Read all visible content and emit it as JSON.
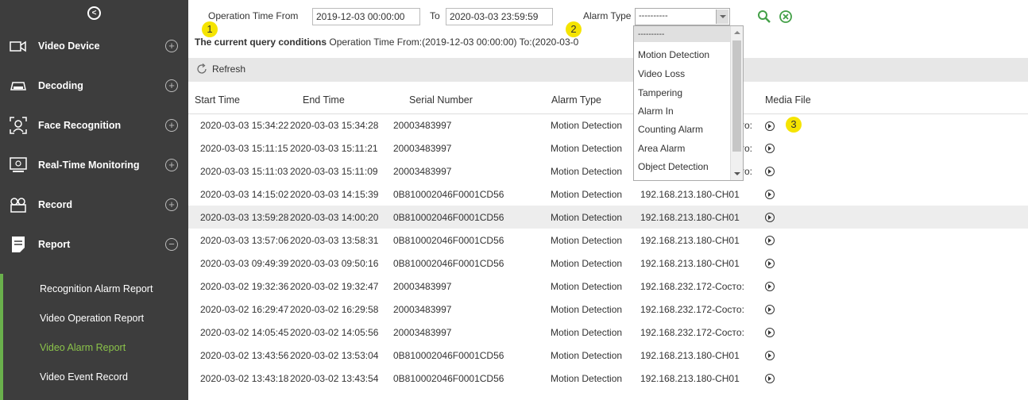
{
  "sidebar": {
    "items": [
      {
        "label": "Video Device",
        "icon": "video-device-icon",
        "expand": "+"
      },
      {
        "label": "Decoding",
        "icon": "decoding-icon",
        "expand": "+"
      },
      {
        "label": "Face Recognition",
        "icon": "face-recognition-icon",
        "expand": "+"
      },
      {
        "label": "Real-Time Monitoring",
        "icon": "monitor-icon",
        "expand": "+"
      },
      {
        "label": "Record",
        "icon": "record-icon",
        "expand": "+"
      },
      {
        "label": "Report",
        "icon": "report-icon",
        "expand": "−"
      }
    ],
    "submenu": [
      {
        "label": "Recognition Alarm Report"
      },
      {
        "label": "Video Operation Report"
      },
      {
        "label": "Video Alarm Report"
      },
      {
        "label": "Video Event Record"
      }
    ]
  },
  "filter": {
    "from_label": "Operation Time From",
    "from_value": "2019-12-03 00:00:00",
    "to_label": "To",
    "to_value": "2020-03-03 23:59:59",
    "alarm_type_label": "Alarm Type",
    "alarm_type_value": "----------"
  },
  "condition": {
    "label": "The current query conditions",
    "text": "Operation Time From:(2019-12-03 00:00:00)  To:(2020-03-0"
  },
  "toolbar": {
    "refresh_label": "Refresh"
  },
  "table": {
    "headers": [
      "Start Time",
      "End Time",
      "Serial Number",
      "Alarm Type",
      "",
      "Media File"
    ],
    "rows": [
      [
        "2020-03-03 15:34:22",
        "2020-03-03 15:34:28",
        "20003483997",
        "Motion Detection",
        "cтo:"
      ],
      [
        "2020-03-03 15:11:15",
        "2020-03-03 15:11:21",
        "20003483997",
        "Motion Detection",
        "cтo:"
      ],
      [
        "2020-03-03 15:11:03",
        "2020-03-03 15:11:09",
        "20003483997",
        "Motion Detection",
        "cтo:"
      ],
      [
        "2020-03-03 14:15:02",
        "2020-03-03 14:15:39",
        "0B810002046F0001CD56",
        "Motion Detection",
        "192.168.213.180-CH01"
      ],
      [
        "2020-03-03 13:59:28",
        "2020-03-03 14:00:20",
        "0B810002046F0001CD56",
        "Motion Detection",
        "192.168.213.180-CH01"
      ],
      [
        "2020-03-03 13:57:06",
        "2020-03-03 13:58:31",
        "0B810002046F0001CD56",
        "Motion Detection",
        "192.168.213.180-CH01"
      ],
      [
        "2020-03-03 09:49:39",
        "2020-03-03 09:50:16",
        "0B810002046F0001CD56",
        "Motion Detection",
        "192.168.213.180-CH01"
      ],
      [
        "2020-03-02 19:32:36",
        "2020-03-02 19:32:47",
        "20003483997",
        "Motion Detection",
        "192.168.232.172-Cocтo:"
      ],
      [
        "2020-03-02 16:29:47",
        "2020-03-02 16:29:58",
        "20003483997",
        "Motion Detection",
        "192.168.232.172-Cocтo:"
      ],
      [
        "2020-03-02 14:05:45",
        "2020-03-02 14:05:56",
        "20003483997",
        "Motion Detection",
        "192.168.232.172-Cocтo:"
      ],
      [
        "2020-03-02 13:43:56",
        "2020-03-02 13:53:04",
        "0B810002046F0001CD56",
        "Motion Detection",
        "192.168.213.180-CH01"
      ],
      [
        "2020-03-02 13:43:18",
        "2020-03-02 13:43:54",
        "0B810002046F0001CD56",
        "Motion Detection",
        "192.168.213.180-CH01"
      ]
    ]
  },
  "dropdown": {
    "options": [
      "----------",
      "Motion Detection",
      "Video Loss",
      "Tampering",
      "Alarm In",
      "Counting Alarm",
      "Area Alarm",
      "Object Detection"
    ]
  },
  "badges": [
    "1",
    "2",
    "3"
  ],
  "colors": {
    "sidebar_bg": "#3d3d3d",
    "active_green": "#8bc34a",
    "badge": "#f5e400",
    "search_green": "#43a047"
  }
}
